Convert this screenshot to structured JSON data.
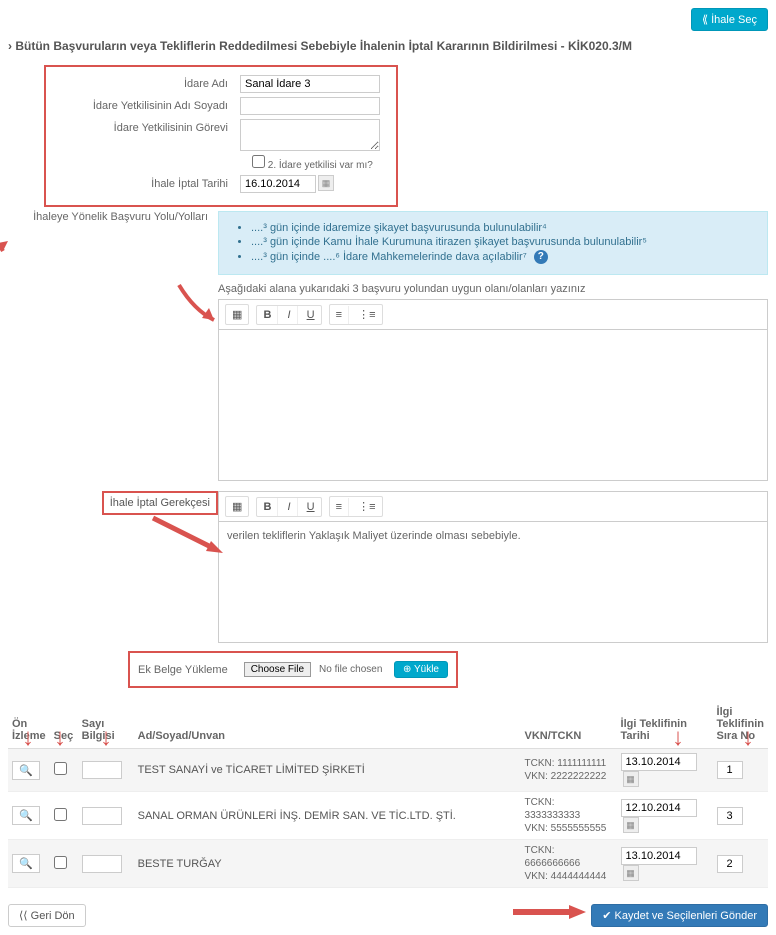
{
  "top_button": "⟪ İhale Seç",
  "page_title": "Bütün Başvuruların veya Tekliflerin Reddedilmesi Sebebiyle İhalenin İptal Kararının Bildirilmesi - KİK020.3/M",
  "form": {
    "idare_adi_label": "İdare Adı",
    "idare_adi_value": "Sanal İdare 3",
    "yetkili_adi_label": "İdare Yetkilisinin Adı Soyadı",
    "yetkili_adi_value": "",
    "yetkili_gorev_label": "İdare Yetkilisinin Görevi",
    "yetkili_gorev_value": "",
    "ikinci_yetkili_label": "2. İdare yetkilisi var mı?",
    "iptal_tarih_label": "İhale İptal Tarihi",
    "iptal_tarih_value": "16.10.2014"
  },
  "basvuru_label": "İhaleye Yönelik Başvuru Yolu/Yolları",
  "info_items": [
    "....³ gün içinde idaremize şikayet başvurusunda bulunulabilir⁴",
    "....³ gün içinde Kamu İhale Kurumuna itirazen şikayet başvurusunda bulunulabilir⁵",
    "....³ gün içinde ....⁶ İdare Mahkemelerinde dava açılabilir⁷"
  ],
  "instruction_text": "Aşağıdaki alana yukarıdaki 3 başvuru yolundan uygun olanı/olanları yazınız",
  "gerekce_label": "İhale İptal Gerekçesi",
  "gerekce_content": "verilen tekliflerin Yaklaşık Maliyet üzerinde olması sebebiyle.",
  "upload": {
    "label": "Ek Belge Yükleme",
    "choose": "Choose File",
    "no_file": "No file chosen",
    "btn": "⊕ Yükle"
  },
  "table": {
    "headers": {
      "on_izleme": "Ön İzleme",
      "sec": "Seç",
      "sayi": "Sayı Bilgisi",
      "unvan": "Ad/Soyad/Unvan",
      "vkn": "VKN/TCKN",
      "tarih": "İlgi Teklifinin Tarihi",
      "sira": "İlgi Teklifinin Sıra No"
    },
    "rows": [
      {
        "unvan": "TEST SANAYİ ve TİCARET LİMİTED ŞİRKETİ",
        "tckn": "TCKN: 1111111111",
        "vkn": "VKN: 2222222222",
        "tarih": "13.10.2014",
        "sira": "1"
      },
      {
        "unvan": "SANAL ORMAN ÜRÜNLERİ İNŞ. DEMİR SAN. VE TİC.LTD. ŞTİ.",
        "tckn": "TCKN: 3333333333",
        "vkn": "VKN: 5555555555",
        "tarih": "12.10.2014",
        "sira": "3"
      },
      {
        "unvan": "BESTE TURĞAY",
        "tckn": "TCKN: 6666666666",
        "vkn": "VKN: 4444444444",
        "tarih": "13.10.2014",
        "sira": "2"
      }
    ]
  },
  "footer": {
    "back": "⟨⟨ Geri Dön",
    "save": "✔ Kaydet ve Seçilenleri Gönder"
  }
}
